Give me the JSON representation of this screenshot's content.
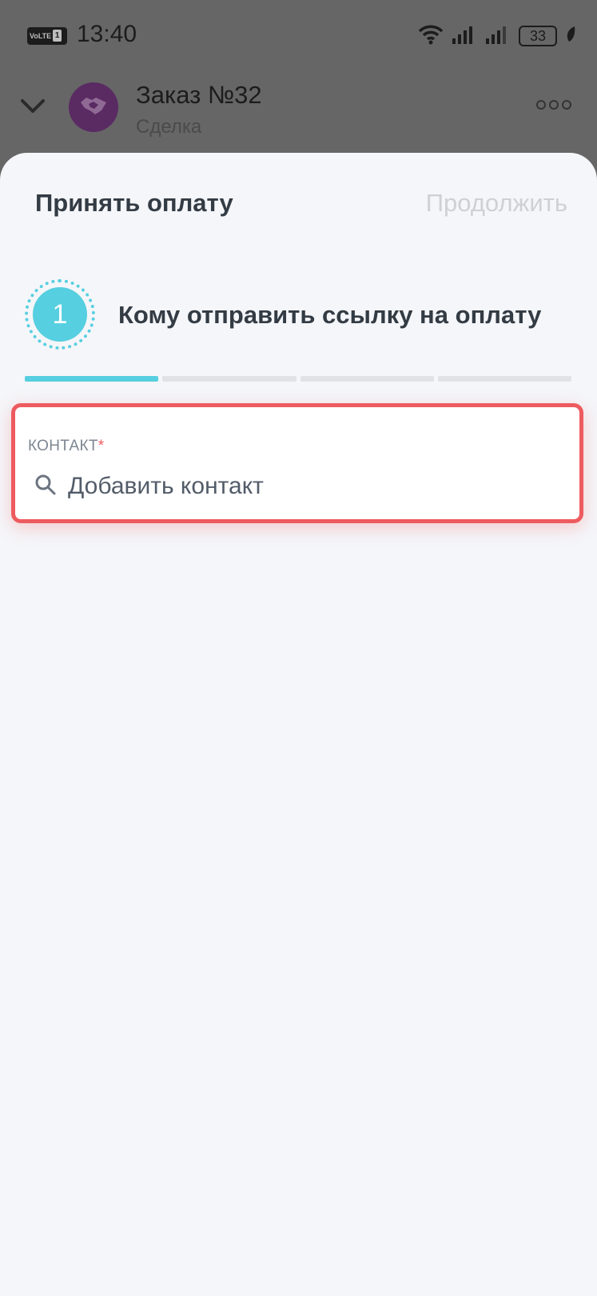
{
  "status_bar": {
    "volte": "VoLTE",
    "sim": "1",
    "time": "13:40",
    "battery": "33"
  },
  "header": {
    "title": "Заказ №32",
    "subtitle": "Сделка"
  },
  "sheet": {
    "title": "Принять оплату",
    "continue_label": "Продолжить",
    "step": {
      "number": "1",
      "title": "Кому отправить ссылку на оплату"
    },
    "progress": {
      "total_steps": 4,
      "current_step": 1
    },
    "contact_field": {
      "label": "КОНТАКТ",
      "required_mark": "*",
      "placeholder": "Добавить контакт"
    }
  },
  "colors": {
    "accent": "#56cfe0",
    "error": "#ed5b5f",
    "avatar": "#5a2a63"
  },
  "icons": [
    "chevron-down-icon",
    "handshake-icon",
    "more-icon",
    "search-icon",
    "wifi-icon",
    "signal-icon",
    "battery-icon",
    "leaf-icon"
  ]
}
